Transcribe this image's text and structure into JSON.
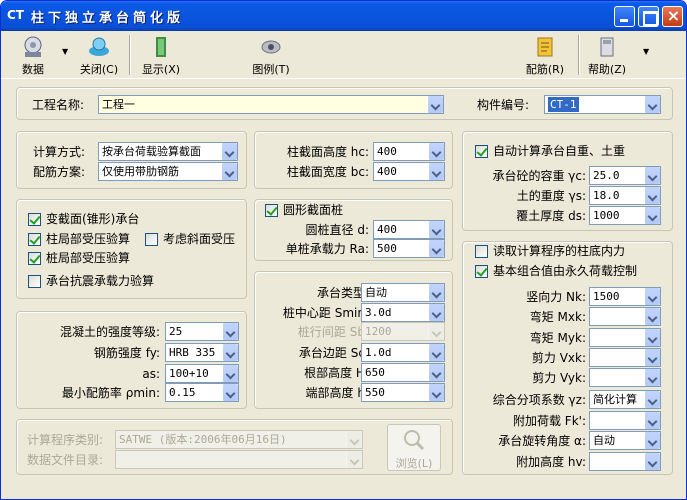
{
  "window": {
    "logo": "CT",
    "title": "柱下独立承台简化版"
  },
  "toolbar": {
    "data": "数据",
    "close": "关闭(C)",
    "display": "显示(X)",
    "legend": "图例(T)",
    "rebar": "配筋(R)",
    "help": "帮助(Z)"
  },
  "header": {
    "project_label": "工程名称:",
    "project_value": "工程一",
    "member_label": "构件编号:",
    "member_value": "CT-1"
  },
  "calc": {
    "method_label": "计算方式:",
    "method_value": "按承台荷载验算截面",
    "rebar_label": "配筋方案:",
    "rebar_value": "仅使用带肋钢筋"
  },
  "options": {
    "variable_section": "变截面(锥形)承台",
    "column_local": "柱局部受压验算",
    "inclined": "考虑斜面受压",
    "pile_local": "桩局部受压验算",
    "seismic": "承台抗震承载力验算"
  },
  "material": {
    "concrete_label": "混凝土的强度等级:",
    "concrete_value": "25",
    "steel_label": "钢筋强度 fy:",
    "steel_value": "HRB 335",
    "as_label": "as:",
    "as_value": "100+10",
    "rho_label": "最小配筋率 ρmin:",
    "rho_value": "0.15"
  },
  "column": {
    "hc_label": "柱截面高度 hc:",
    "hc_value": "400",
    "bc_label": "柱截面宽度 bc:",
    "bc_value": "400"
  },
  "pile": {
    "round_label": "圆形截面桩",
    "d_label": "圆桩直径 d:",
    "d_value": "400",
    "ra_label": "单桩承载力 Ra:",
    "ra_value": "500"
  },
  "cap": {
    "type_label": "承台类型:",
    "type_value": "自动",
    "smin_label": "桩中心距 Smin:",
    "smin_value": "3.0d",
    "sb_label": "桩行间距 Sb:",
    "sb_value": "1200",
    "sc_label": "承台边距 Sc:",
    "sc_value": "1.0d",
    "h_label": "根部高度 H:",
    "h_value": "650",
    "hend_label": "端部高度 h:",
    "hend_value": "550"
  },
  "selfweight": {
    "auto_label": "自动计算承台自重、土重",
    "yc_label": "承台砼的容重 γc:",
    "yc_value": "25.0",
    "ys_label": "土的重度 γs:",
    "ys_value": "18.0",
    "ds_label": "覆土厚度 ds:",
    "ds_value": "1000"
  },
  "loads": {
    "read_label": "读取计算程序的柱底内力",
    "perm_label": "基本组合值由永久荷载控制",
    "nk_label": "竖向力 Nk:",
    "nk_value": "1500",
    "mxk_label": "弯矩 Mxk:",
    "myk_label": "弯矩 Myk:",
    "vxk_label": "剪力 Vxk:",
    "vyk_label": "剪力 Vyk:",
    "yz_label": "综合分项系数 γz:",
    "yz_value": "简化计算",
    "fk_label": "附加荷载 Fk':",
    "alpha_label": "承台旋转角度 α:",
    "alpha_value": "自动",
    "hv_label": "附加高度 hv:"
  },
  "program": {
    "type_label": "计算程序类别:",
    "type_value": "SATWE (版本:2006年06月16日)",
    "dir_label": "数据文件目录:",
    "browse_label": "浏览(L)"
  }
}
